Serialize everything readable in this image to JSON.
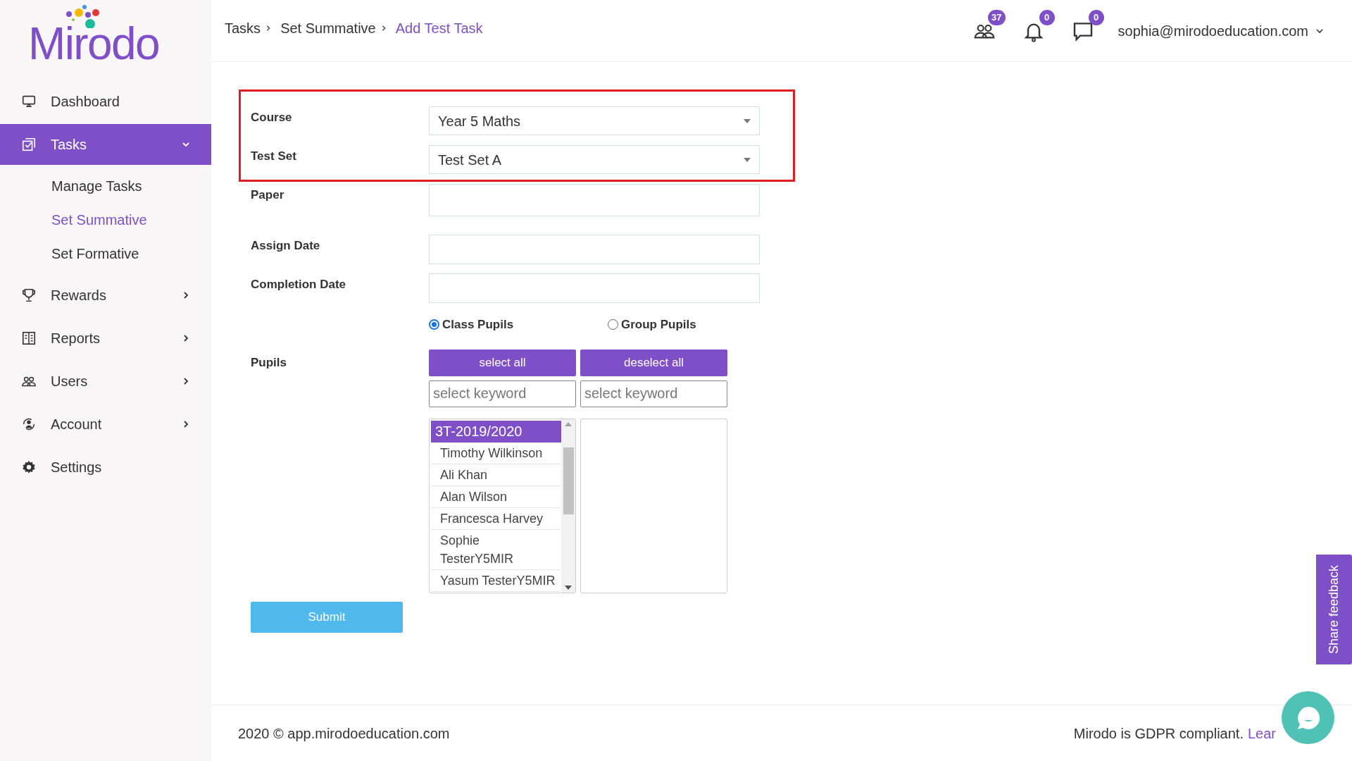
{
  "logo": {
    "text": "Mirodo"
  },
  "sidebar": {
    "items": [
      {
        "label": "Dashboard",
        "kind": "link",
        "selected": false
      },
      {
        "label": "Tasks",
        "kind": "group",
        "selected": true,
        "expanded": true,
        "children": [
          {
            "label": "Manage Tasks",
            "selected": false
          },
          {
            "label": "Set Summative",
            "selected": true
          },
          {
            "label": "Set Formative",
            "selected": false
          }
        ]
      },
      {
        "label": "Rewards",
        "kind": "group",
        "selected": false,
        "expanded": false
      },
      {
        "label": "Reports",
        "kind": "group",
        "selected": false,
        "expanded": false
      },
      {
        "label": "Users",
        "kind": "group",
        "selected": false,
        "expanded": false
      },
      {
        "label": "Account",
        "kind": "group",
        "selected": false,
        "expanded": false
      },
      {
        "label": "Settings",
        "kind": "link",
        "selected": false
      }
    ]
  },
  "breadcrumb": [
    {
      "label": "Tasks",
      "current": false
    },
    {
      "label": "Set Summative",
      "current": false
    },
    {
      "label": "Add Test Task",
      "current": true
    }
  ],
  "header": {
    "badges": [
      {
        "count": "37"
      },
      {
        "count": "0"
      },
      {
        "count": "0"
      }
    ],
    "user": "sophia@mirodoeducation.com"
  },
  "form": {
    "fields": [
      {
        "label": "Course",
        "kind": "select",
        "value": "Year 5 Maths",
        "highlighted": true
      },
      {
        "label": "Test Set",
        "kind": "select",
        "value": "Test Set A",
        "highlighted": true
      },
      {
        "label": "Paper",
        "kind": "text",
        "highlighted": false
      },
      {
        "label": "Assign Date",
        "kind": "text",
        "highlighted": false
      },
      {
        "label": "Completion Date",
        "kind": "text",
        "highlighted": false
      }
    ],
    "radios": [
      {
        "label": "Class Pupils",
        "selected": true
      },
      {
        "label": "Group Pupils",
        "selected": false
      }
    ],
    "pupils": {
      "label": "Pupils",
      "buttons": [
        "select all",
        "deselect all"
      ],
      "search_placeholders": [
        "select keyword",
        "select keyword"
      ],
      "available": [
        {
          "label": "3T-2019/2020",
          "kind": "group"
        },
        {
          "label": "Timothy Wilkinson",
          "kind": "pupil"
        },
        {
          "label": "Ali Khan",
          "kind": "pupil"
        },
        {
          "label": "Alan Wilson",
          "kind": "pupil"
        },
        {
          "label": "Francesca Harvey",
          "kind": "pupil"
        },
        {
          "label": "Sophie TesterY5MIR",
          "kind": "pupil"
        },
        {
          "label": "Yasum TesterY5MIR",
          "kind": "pupil"
        }
      ]
    },
    "submit": "Submit"
  },
  "footer": {
    "copyright": "2020 © app.mirodoeducation.com",
    "gdpr": "Mirodo is GDPR compliant.",
    "link": "Lear"
  },
  "feedback_tab": "Share feedback"
}
